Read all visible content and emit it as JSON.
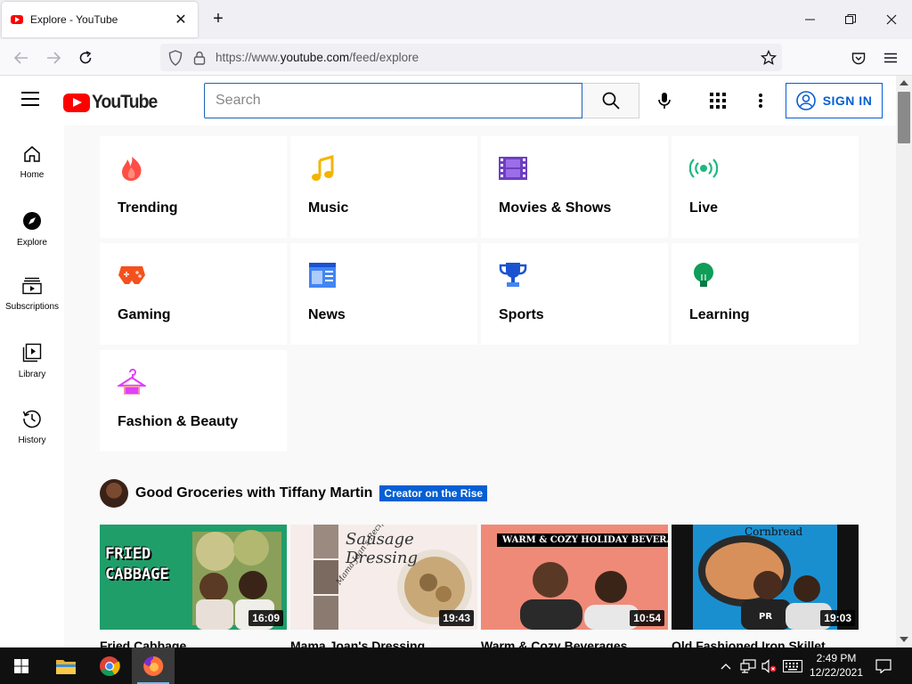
{
  "browser": {
    "tab_title": "Explore - YouTube",
    "url_prefix": "https://www.",
    "url_host": "youtube.com",
    "url_path": "/feed/explore"
  },
  "header": {
    "logo_text": "YouTube",
    "search_placeholder": "Search",
    "sign_in_label": "SIGN IN"
  },
  "sidebar": {
    "items": [
      {
        "label": "Home",
        "icon": "home-icon"
      },
      {
        "label": "Explore",
        "icon": "compass-icon"
      },
      {
        "label": "Subscriptions",
        "icon": "subscriptions-icon"
      },
      {
        "label": "Library",
        "icon": "library-icon"
      },
      {
        "label": "History",
        "icon": "history-icon"
      }
    ]
  },
  "categories": [
    {
      "label": "Trending",
      "icon": "flame-icon",
      "color": "#ff4e45"
    },
    {
      "label": "Music",
      "icon": "music-note-icon",
      "color": "#f4b400"
    },
    {
      "label": "Movies & Shows",
      "icon": "film-strip-icon",
      "color": "#6d3fc1"
    },
    {
      "label": "Live",
      "icon": "live-broadcast-icon",
      "color": "#1eb980"
    },
    {
      "label": "Gaming",
      "icon": "game-controller-icon",
      "color": "#f4511e"
    },
    {
      "label": "News",
      "icon": "newspaper-icon",
      "color": "#4285f4"
    },
    {
      "label": "Sports",
      "icon": "trophy-icon",
      "color": "#1a53d1"
    },
    {
      "label": "Learning",
      "icon": "lightbulb-icon",
      "color": "#0f9d58"
    },
    {
      "label": "Fashion & Beauty",
      "icon": "hanger-icon",
      "color": "#e040fb"
    }
  ],
  "channel": {
    "name": "Good Groceries with Tiffany Martin",
    "badge": "Creator on the Rise"
  },
  "videos": [
    {
      "title": "Fried Cabbage",
      "duration": "16:09",
      "thumb_text": "FRIED CABBAGE"
    },
    {
      "title": "Mama Joan's Dressing",
      "duration": "19:43",
      "thumb_text": "Sausage Dressing",
      "thumb_subtext": "Mama Joan's Recipe"
    },
    {
      "title": "Warm & Cozy Beverages",
      "duration": "10:54",
      "thumb_text": "WARM & COZY HOLIDAY BEVERAGES"
    },
    {
      "title": "Old Fashioned Iron Skillet",
      "duration": "19:03",
      "thumb_text": "Cornbread"
    }
  ],
  "taskbar": {
    "time": "2:49 PM",
    "date": "12/22/2021"
  },
  "colors": {
    "youtube_red": "#ff0000",
    "link_blue": "#065fd4",
    "page_bg": "#f9f9f9"
  }
}
